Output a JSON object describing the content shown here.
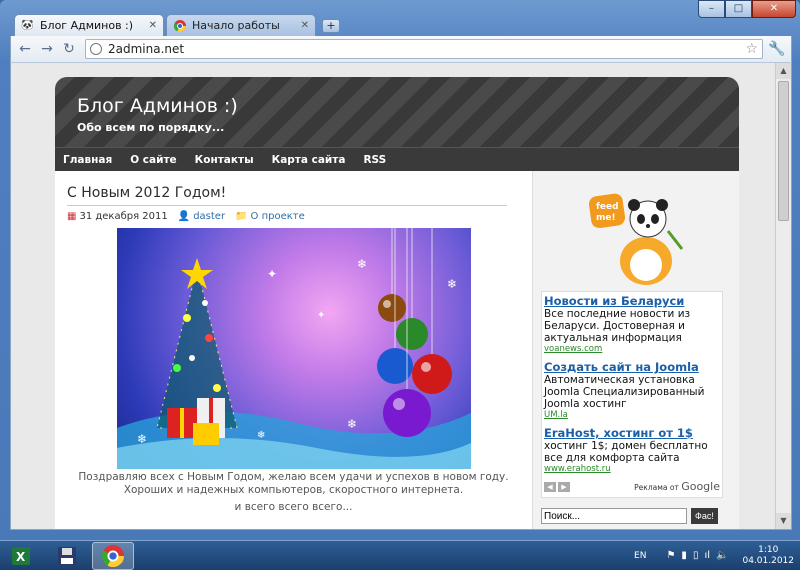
{
  "window": {
    "controls": [
      "–",
      "□",
      "✕"
    ]
  },
  "tabs": [
    {
      "label": "Блог Админов :)",
      "active": true
    },
    {
      "label": "Начало работы",
      "active": false
    }
  ],
  "toolbar": {
    "url": "2admina.net"
  },
  "site": {
    "title": "Блог Админов :)",
    "description": "Обо всем по порядку...",
    "menu": [
      "Главная",
      "О сайте",
      "Контакты",
      "Карта сайта",
      "RSS"
    ]
  },
  "post": {
    "title": "С Новым 2012 Годом!",
    "date": "31 декабря 2011",
    "author": "daster",
    "category": "О проекте",
    "text": "Поздравляю всех с Новым Годом, желаю всем удачи и успехов в новом году. Хороших и надежных компьютеров, скоростного интернета.",
    "more": "и всего всего всего..."
  },
  "sidebar": {
    "feed_label": "feed me!",
    "ads": [
      {
        "title": "Новости из Беларуси",
        "body": "Все последние новости из Беларуси. Достоверная и актуальная информация",
        "url": "voanews.com"
      },
      {
        "title": "Создать сайт на Joomla",
        "body": "Автоматическая установка Joomla Специализированный Joomla хостинг",
        "url": "UM.la"
      },
      {
        "title": "EraHost, хостинг от 1$",
        "body": "хостинг 1$; домен бесплатно все для комфорта сайта",
        "url": "www.erahost.ru"
      }
    ],
    "ad_credit": "Реклама от",
    "ad_credit_brand": "Google",
    "search_placeholder": "Поиск...",
    "search_button": "Фас!"
  },
  "taskbar": {
    "lang": "EN",
    "time": "1:10",
    "date": "04.01.2012"
  }
}
